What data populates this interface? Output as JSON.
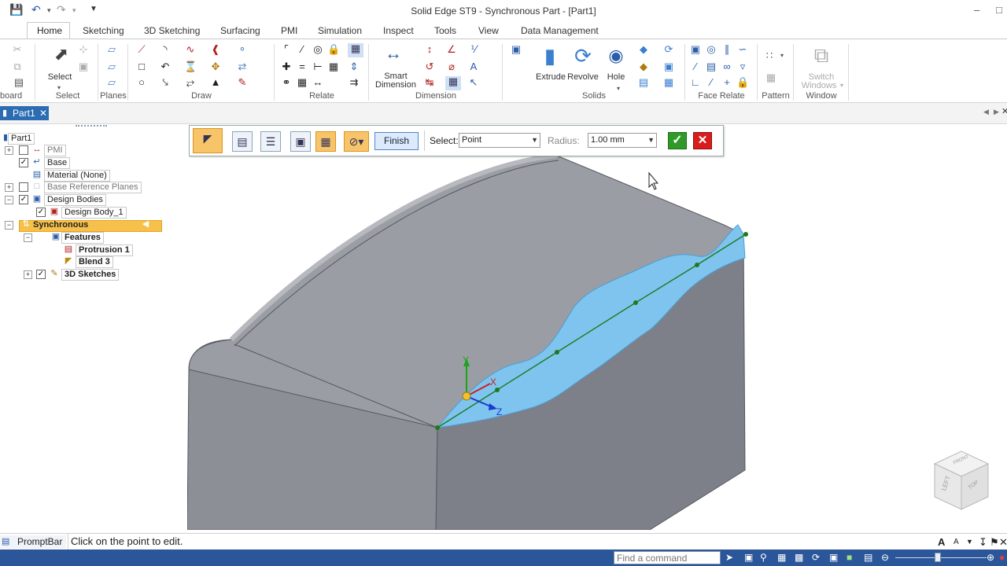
{
  "window": {
    "title": "Solid Edge ST9 - Synchronous Part - [Part1]"
  },
  "ribbon_tabs": [
    "Home",
    "Sketching",
    "3D Sketching",
    "Surfacing",
    "PMI",
    "Simulation",
    "Inspect",
    "Tools",
    "View",
    "Data Management"
  ],
  "ribbon_groups": {
    "clipboard": "board",
    "select": {
      "label": "Select",
      "button": "Select"
    },
    "planes": "Planes",
    "draw": "Draw",
    "relate": "Relate",
    "dimension": {
      "label": "Dimension",
      "button_line1": "Smart",
      "button_line2": "Dimension"
    },
    "solids": {
      "label": "Solids",
      "extrude": "Extrude",
      "revolve": "Revolve",
      "hole": "Hole"
    },
    "face_relate": "Face Relate",
    "pattern": "Pattern",
    "window": {
      "label": "Window",
      "button_line1": "Switch",
      "button_line2": "Windows"
    }
  },
  "document_tab": "Part1",
  "pathfinder": {
    "root": "Part1",
    "nodes": [
      {
        "label": "PMI"
      },
      {
        "label": "Base"
      },
      {
        "label": "Material (None)"
      },
      {
        "label": "Base Reference Planes"
      },
      {
        "label": "Design Bodies"
      },
      {
        "label": "Design Body_1"
      },
      {
        "label": "Synchronous"
      },
      {
        "label": "Features"
      },
      {
        "label": "Protrusion 1"
      },
      {
        "label": "Blend 3"
      },
      {
        "label": "3D Sketches"
      }
    ]
  },
  "command_bar": {
    "finish": "Finish",
    "select_label": "Select:",
    "select_value": "Point",
    "radius_label": "Radius:",
    "radius_value": "1.00 mm"
  },
  "triad_axes": {
    "y": "Y",
    "x": "X",
    "z": "Z"
  },
  "view_cube": {
    "left": "LEFT",
    "top": "TOP",
    "front": "FRONT"
  },
  "prompt_bar": {
    "label": "PromptBar",
    "text": "Click on the point to edit."
  },
  "status_bar": {
    "find_placeholder": "Find a command"
  },
  "colors": {
    "accent": "#2b6cb2",
    "status_bar": "#2b579a",
    "model_face_top": "#8f9298",
    "model_face_front": "#7c7f86",
    "blend_surface": "#7ec4ee",
    "highlight": "#f6c04b"
  }
}
